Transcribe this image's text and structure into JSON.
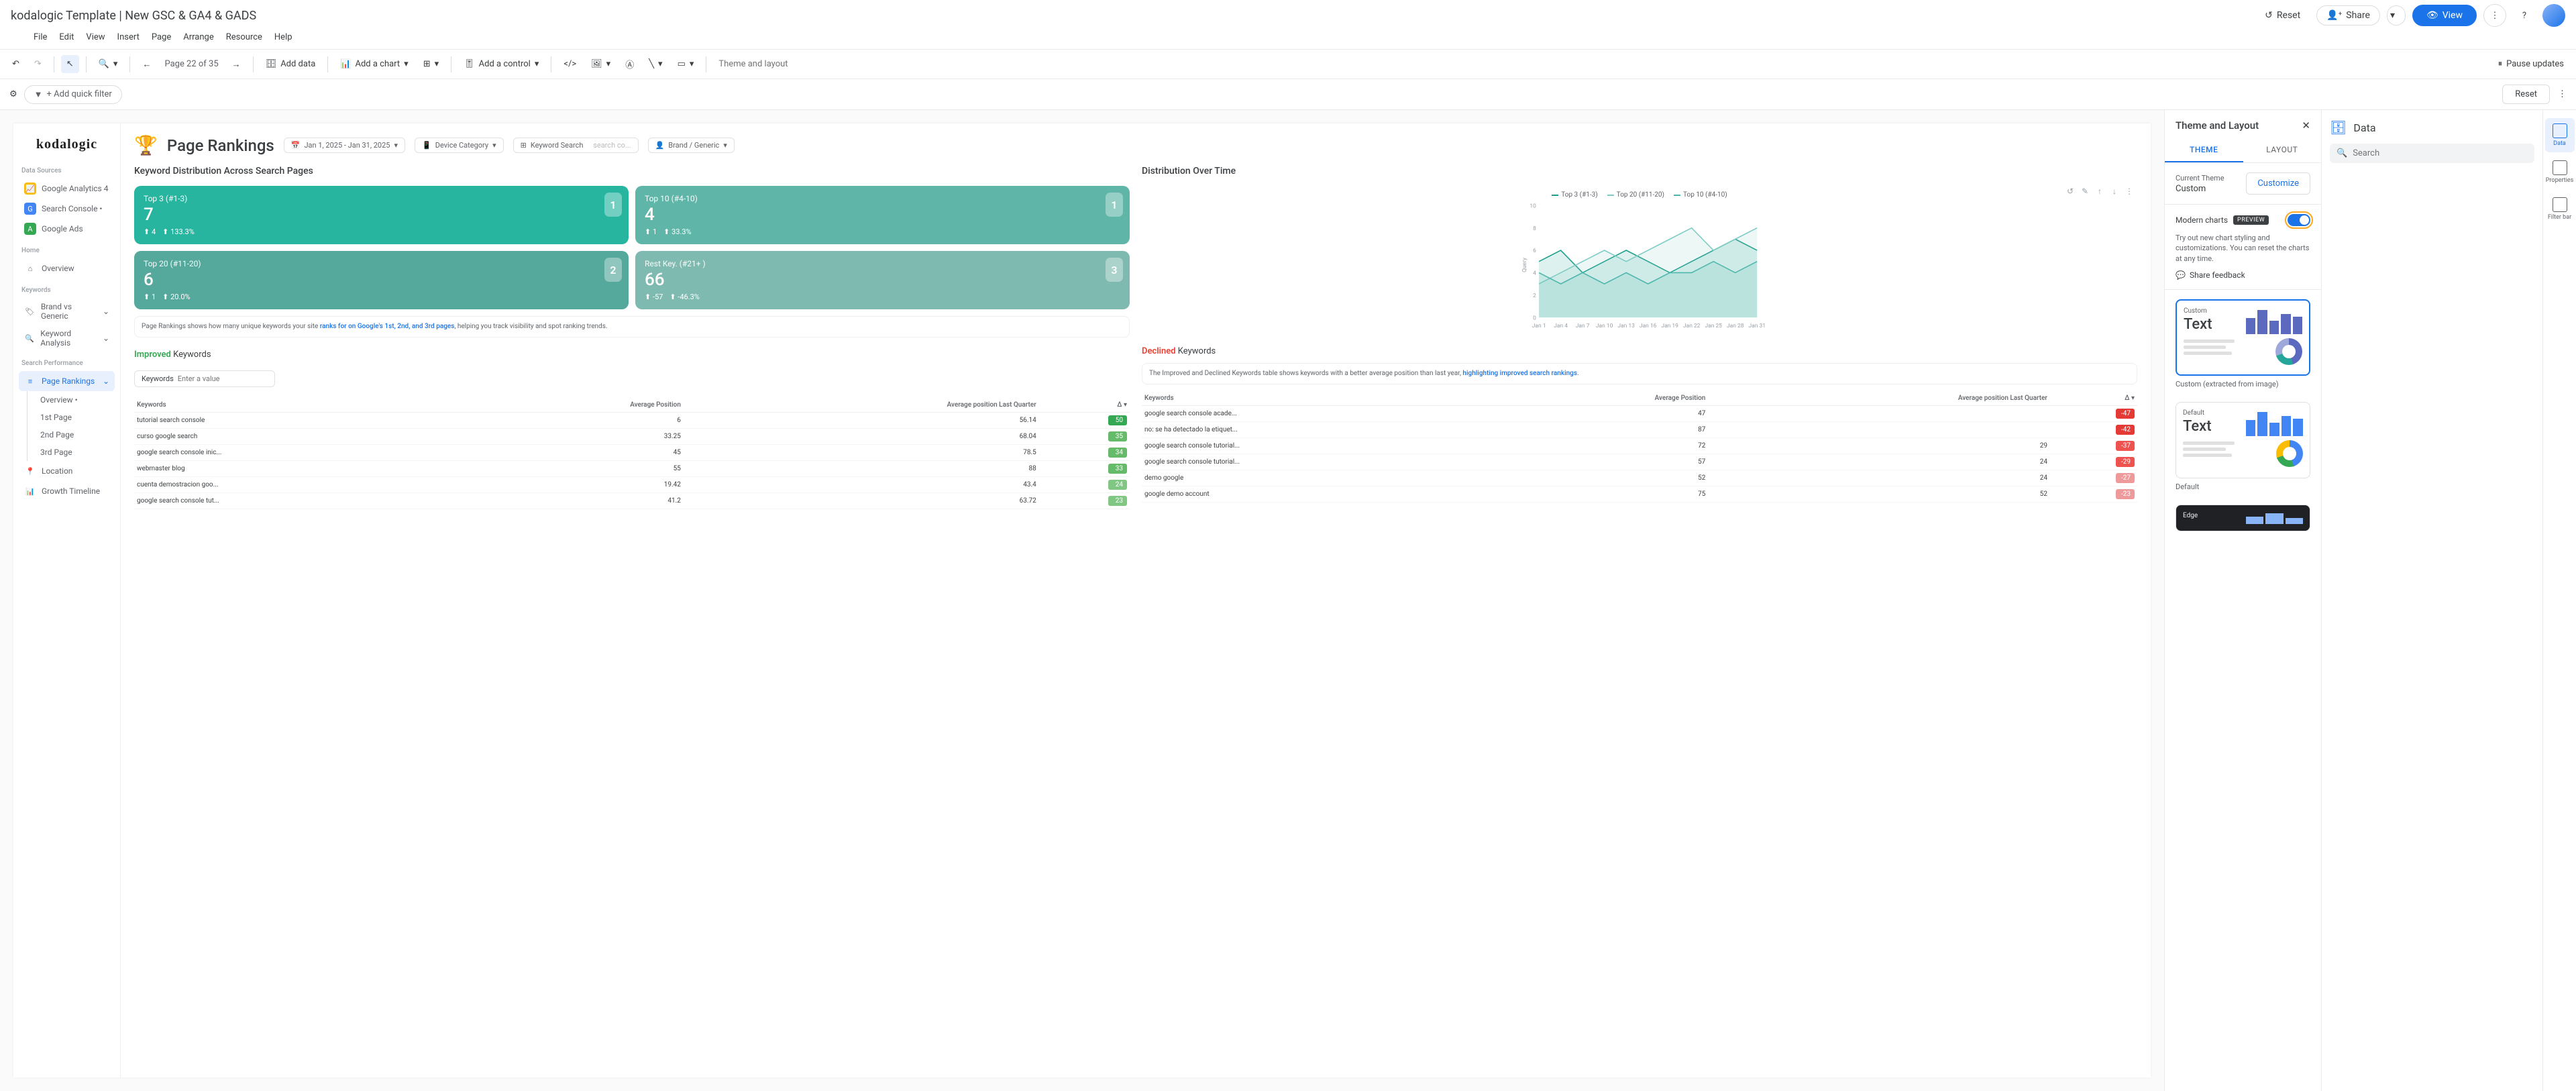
{
  "header": {
    "title": "kodalogic Template | New GSC & GA4 & GADS",
    "reset": "Reset",
    "share": "Share",
    "view": "View",
    "pause": "Pause updates"
  },
  "menu": [
    "File",
    "Edit",
    "View",
    "Insert",
    "Page",
    "Arrange",
    "Resource",
    "Help"
  ],
  "toolbar": {
    "page": "Page 22 of 35",
    "add_data": "Add data",
    "add_chart": "Add a chart",
    "add_control": "Add a control",
    "theme_ph": "Theme and layout"
  },
  "filter": {
    "add": "+ Add quick filter",
    "reset": "Reset"
  },
  "side": {
    "brand": "kodalogic",
    "h1": "Data Sources",
    "ds": [
      "Google Analytics 4",
      "Search Console •",
      "Google Ads"
    ],
    "h2": "Home",
    "home": "Overview",
    "h3": "Keywords",
    "kw": [
      "Brand vs Generic",
      "Keyword Analysis"
    ],
    "h4": "Search Performance",
    "sp": "Page Rankings",
    "subs": [
      "Overview •",
      "1st Page",
      "2nd Page",
      "3rd Page"
    ],
    "loc": "Location",
    "gt": "Growth Timeline"
  },
  "report": {
    "title": "Page Rankings",
    "date": "Jan 1, 2025 - Jan 31, 2025",
    "device": "Device Category",
    "kw_lbl": "Keyword Search",
    "kw_ph": "search co...",
    "brand": "Brand / Generic",
    "sec1": "Keyword Distribution Across Search Pages",
    "sec2": "Distribution Over Time",
    "cards": [
      {
        "t": "Top 3 (#1-3)",
        "v": "7",
        "d1": "4",
        "d2": "133.3%",
        "b": "1"
      },
      {
        "t": "Top 10 (#4-10)",
        "v": "4",
        "d1": "1",
        "d2": "33.3%",
        "b": "1"
      },
      {
        "t": "Top 20 (#11-20)",
        "v": "6",
        "d1": "1",
        "d2": "20.0%",
        "b": "2"
      },
      {
        "t": "Rest Key. (#21+ )",
        "v": "66",
        "d1": "-57",
        "d2": "-46.3%",
        "b": "3"
      }
    ],
    "note1a": "Page Rankings shows how many unique keywords your site ",
    "note1b": "ranks for on Google's 1st, 2nd, and 3rd pages",
    "note1c": ", helping you track visibility and spot ranking trends.",
    "legend": [
      "Top 3 (#1-3)",
      "Top 20 (#11-20)",
      "Top 10 (#4-10)"
    ],
    "imp_t1": "Improved",
    "imp_t2": " Keywords",
    "dec_t1": "Declined",
    "dec_t2": " Keywords",
    "kw_label": "Keywords",
    "kw_ph2": "Enter a value",
    "note2a": "The Improved and Declined Keywords table shows keywords with a better average position than last year, ",
    "note2b": "highlighting improved search rankings",
    "cols": [
      "Keywords",
      "Average Position",
      "Average position Last Quarter",
      "Δ"
    ],
    "imp_rows": [
      {
        "k": "tutorial search console",
        "a": "6",
        "b": "56.14",
        "d": "50",
        "c": "#34a853"
      },
      {
        "k": "curso google search",
        "a": "33.25",
        "b": "68.04",
        "d": "35",
        "c": "#66bb6a"
      },
      {
        "k": "google search console inic...",
        "a": "45",
        "b": "78.5",
        "d": "34",
        "c": "#66bb6a"
      },
      {
        "k": "webmaster blog",
        "a": "55",
        "b": "88",
        "d": "33",
        "c": "#66bb6a"
      },
      {
        "k": "cuenta demostracion goo...",
        "a": "19.42",
        "b": "43.4",
        "d": "24",
        "c": "#81c784"
      },
      {
        "k": "google search console tut...",
        "a": "41.2",
        "b": "63.72",
        "d": "23",
        "c": "#81c784"
      }
    ],
    "dec_rows": [
      {
        "k": "google search console acade...",
        "a": "47",
        "b": "",
        "d": "-47",
        "c": "#e53935"
      },
      {
        "k": "no: se ha detectado la etiquet...",
        "a": "87",
        "b": "",
        "d": "-42",
        "c": "#e53935"
      },
      {
        "k": "google search console tutorial...",
        "a": "72",
        "b": "29",
        "d": "-37",
        "c": "#ef5350"
      },
      {
        "k": "google search console tutorial...",
        "a": "57",
        "b": "24",
        "d": "-29",
        "c": "#ef5350"
      },
      {
        "k": "demo google",
        "a": "52",
        "b": "24",
        "d": "-27",
        "c": "#ef9a9a"
      },
      {
        "k": "google demo account",
        "a": "75",
        "b": "52",
        "d": "-23",
        "c": "#ef9a9a"
      }
    ]
  },
  "chart_data": {
    "type": "line",
    "x": [
      "Jan 1",
      "Jan 4",
      "Jan 7",
      "Jan 10",
      "Jan 13",
      "Jan 16",
      "Jan 19",
      "Jan 22",
      "Jan 25",
      "Jan 28",
      "Jan 31"
    ],
    "ylabel": "Query",
    "ylim": [
      0,
      10
    ],
    "yticks": [
      0,
      2,
      4,
      6,
      8,
      10
    ],
    "series": [
      {
        "name": "Top 3 (#1-3)",
        "color": "#1b9e8a",
        "values": [
          5,
          6,
          4,
          5,
          6,
          5,
          4,
          5,
          6,
          7,
          6
        ]
      },
      {
        "name": "Top 20 (#11-20)",
        "color": "#80cbc4",
        "values": [
          3,
          4,
          5,
          6,
          5,
          6,
          7,
          8,
          6,
          7,
          8
        ]
      },
      {
        "name": "Top 10 (#4-10)",
        "color": "#4db6ac",
        "values": [
          4,
          3,
          4,
          3,
          4,
          3,
          4,
          4,
          5,
          4,
          5
        ]
      }
    ]
  },
  "panel": {
    "title": "Theme and Layout",
    "t1": "THEME",
    "t2": "LAYOUT",
    "cur": "Current Theme",
    "cur_v": "Custom",
    "cust": "Customize",
    "modern": "Modern charts",
    "preview": "PREVIEW",
    "desc": "Try out new chart styling and customizations. You can reset the charts at any time.",
    "fb": "Share feedback",
    "th1": "Custom",
    "th1t": "Text",
    "th1_lbl": "Custom (extracted from image)",
    "th2": "Default",
    "th2t": "Text",
    "th2_lbl": "Default",
    "th3": "Edge"
  },
  "data_panel": {
    "title": "Data",
    "search_ph": "Search"
  },
  "rail": {
    "r1": "Data",
    "r2": "Properties",
    "r3": "Filter bar"
  }
}
